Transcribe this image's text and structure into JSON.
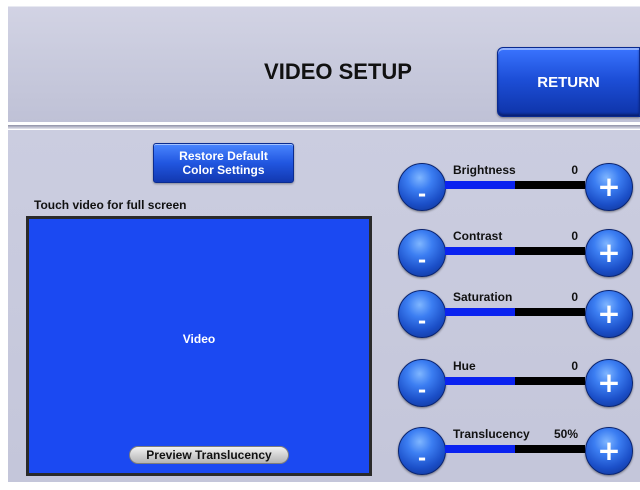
{
  "header": {
    "title": "VIDEO SETUP",
    "return_label": "RETURN"
  },
  "restore_button": {
    "line1": "Restore Default",
    "line2": "Color Settings"
  },
  "video": {
    "hint": "Touch video for full screen",
    "label": "Video",
    "preview_label": "Preview Translucency"
  },
  "icons": {
    "minus": "minus-icon",
    "plus": "plus-icon"
  },
  "colors": {
    "accent_blue": "#1b49f2",
    "slider_fill": "#0a22f0",
    "slider_track": "#000000",
    "panel": "#c7c9dc"
  },
  "adjustments": [
    {
      "label": "Brightness",
      "value": "0",
      "fill": 0.5,
      "decrease": "-",
      "increase": "+"
    },
    {
      "label": "Contrast",
      "value": "0",
      "fill": 0.5,
      "decrease": "-",
      "increase": "+"
    },
    {
      "label": "Saturation",
      "value": "0",
      "fill": 0.5,
      "decrease": "-",
      "increase": "+"
    },
    {
      "label": "Hue",
      "value": "0",
      "fill": 0.5,
      "decrease": "-",
      "increase": "+"
    },
    {
      "label": "Translucency",
      "value": "50%",
      "fill": 0.5,
      "decrease": "-",
      "increase": "+"
    }
  ]
}
